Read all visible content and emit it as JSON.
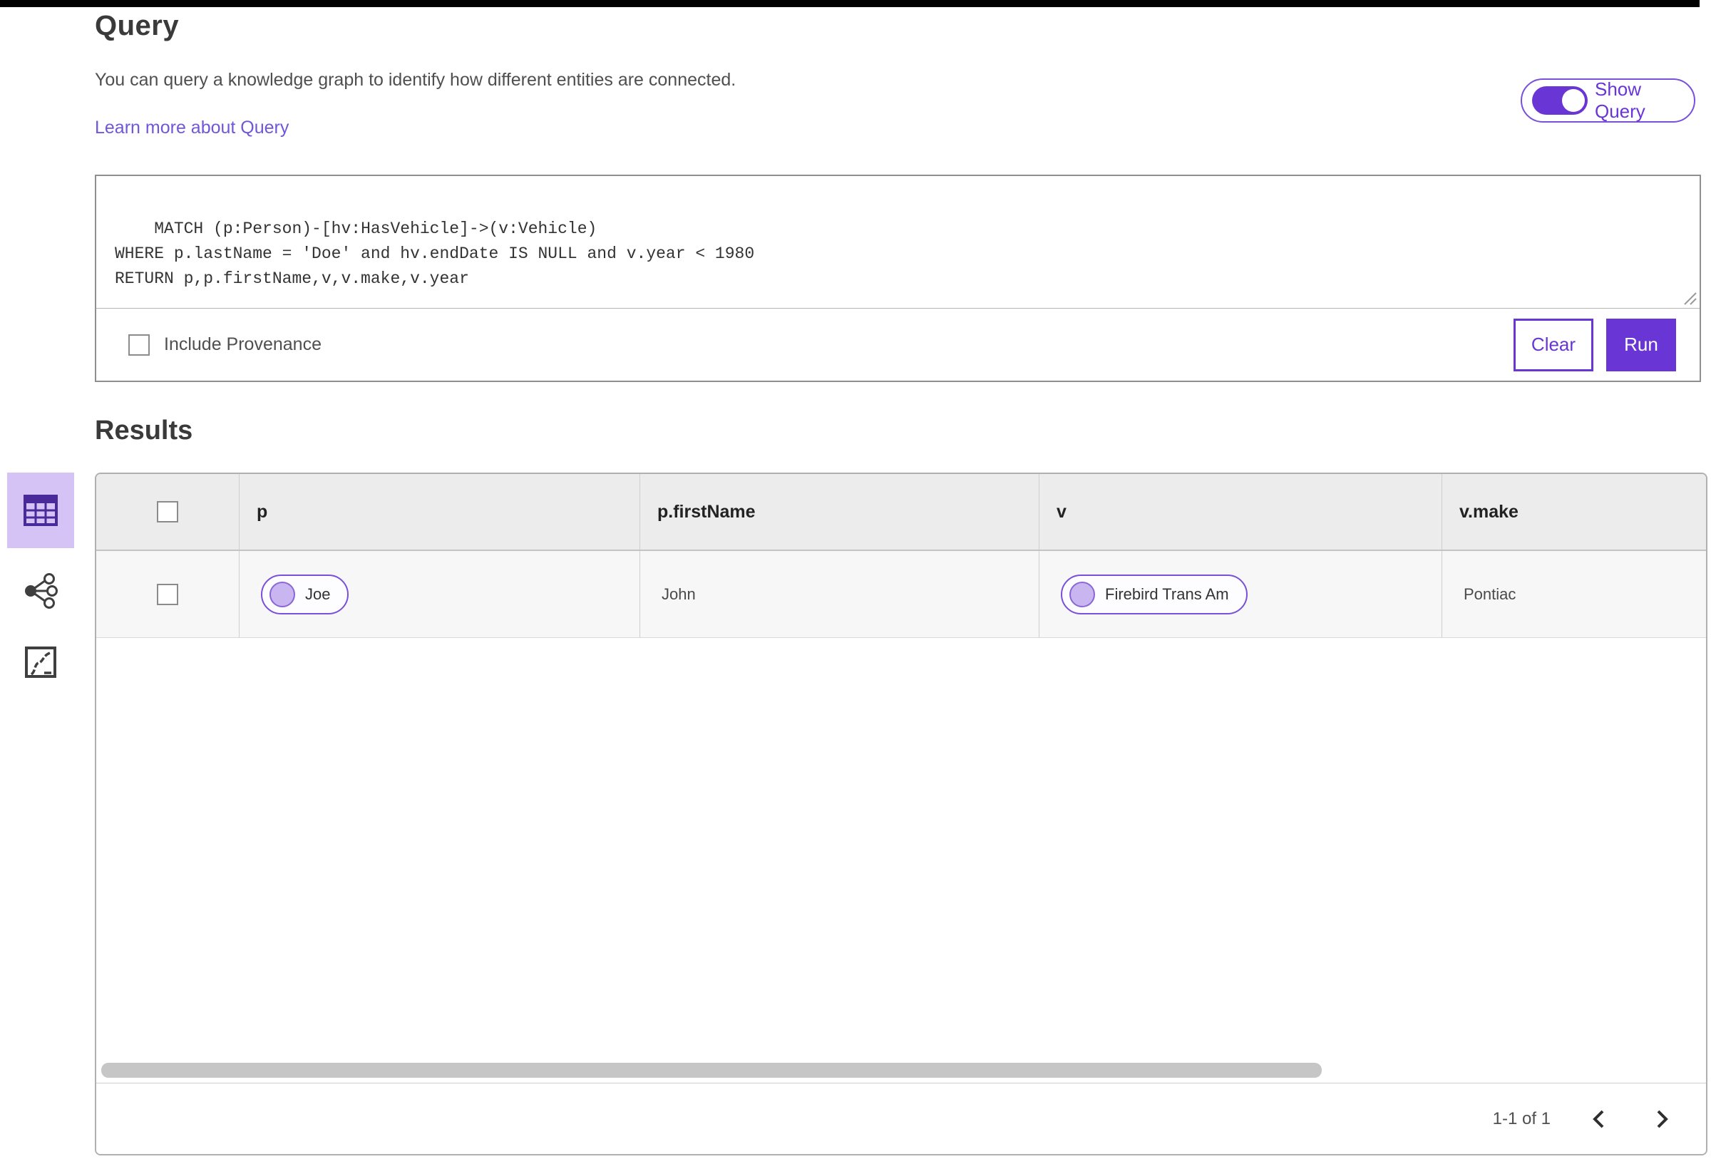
{
  "header": {
    "title": "Query",
    "description": "You can query a knowledge graph to identify how different entities are connected.",
    "learn_more_label": "Learn more about Query",
    "show_query_toggle": {
      "label": "Show Query",
      "state": "on"
    }
  },
  "query_editor": {
    "code": "MATCH (p:Person)-[hv:HasVehicle]->(v:Vehicle)\nWHERE p.lastName = 'Doe' and hv.endDate IS NULL and v.year < 1980\nRETURN p,p.firstName,v,v.make,v.year",
    "include_provenance_label": "Include Provenance",
    "include_provenance_checked": false,
    "clear_label": "Clear",
    "run_label": "Run"
  },
  "results": {
    "title": "Results",
    "view_modes": [
      {
        "name": "table-view",
        "icon": "table-icon",
        "selected": true
      },
      {
        "name": "graph-view",
        "icon": "network-icon",
        "selected": false
      },
      {
        "name": "chart-view",
        "icon": "chart-icon",
        "selected": false
      }
    ],
    "table": {
      "columns": [
        "p",
        "p.firstName",
        "v",
        "v.make"
      ],
      "rows": [
        {
          "selected": false,
          "p_label": "Joe",
          "firstName": "John",
          "v_label": "Firebird Trans Am",
          "make": "Pontiac"
        }
      ]
    },
    "pagination": {
      "range_label": "1-1 of 1"
    }
  },
  "colors": {
    "accent_purple": "#6935d5",
    "pill_border_purple": "#7a4fd9",
    "selected_view_bg": "#d5c3f6",
    "icon_purple": "#4a2a9b",
    "link_purple": "#7156d9",
    "table_header_bg": "#ececec",
    "table_row_bg": "#f7f7f7",
    "topbar_black": "#000000"
  }
}
